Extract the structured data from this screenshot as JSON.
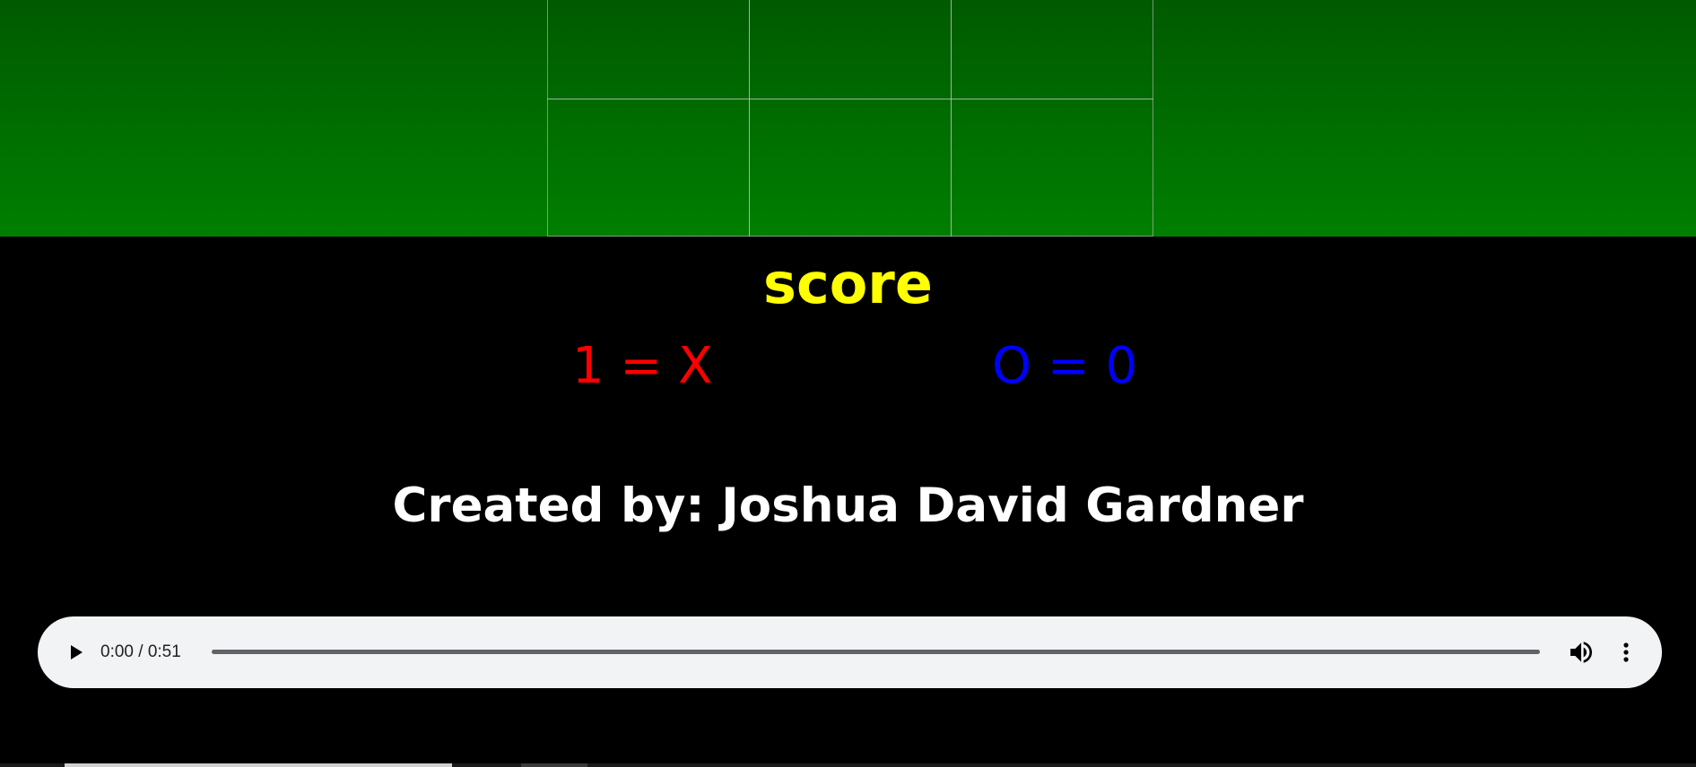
{
  "score": {
    "title": "score",
    "title_color": "#ffff00",
    "player_x": {
      "text": "1 = X",
      "color": "#ff0000"
    },
    "player_o": {
      "text": "O = 0",
      "color": "#0000ff"
    }
  },
  "credits": {
    "text": "Created by: Joshua David Gardner"
  },
  "board": {
    "colors": {
      "top": "#005a00",
      "bottom": "#007f00",
      "grid_line": "#c8c8c8"
    }
  },
  "audio": {
    "time": "0:00 / 0:51",
    "icons": {
      "play": "play-icon",
      "volume": "volume-icon",
      "more": "more-vertical-icon"
    },
    "background": "#f1f3f4"
  }
}
